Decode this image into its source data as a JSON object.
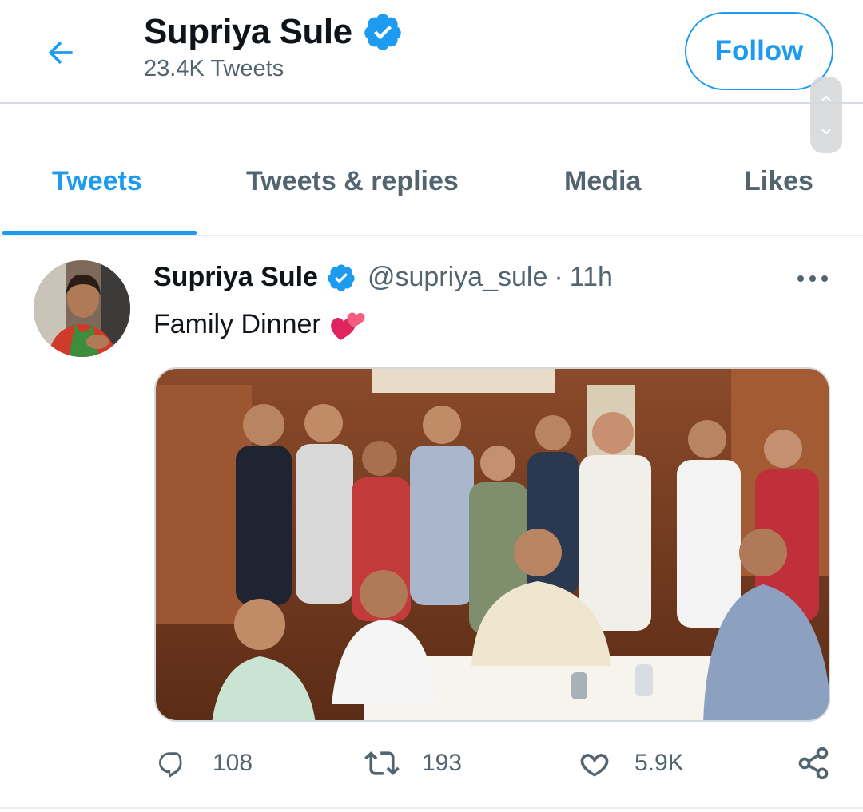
{
  "header": {
    "title": "Supriya Sule",
    "tweet_count": "23.4K Tweets",
    "follow_label": "Follow"
  },
  "tabs": [
    {
      "label": "Tweets",
      "active": true
    },
    {
      "label": "Tweets & replies",
      "active": false
    },
    {
      "label": "Media",
      "active": false
    },
    {
      "label": "Likes",
      "active": false
    }
  ],
  "tweet": {
    "author_name": "Supriya Sule",
    "handle": "@supriya_sule",
    "separator": "·",
    "time": "11h",
    "text": "Family Dinner",
    "stats": {
      "replies": "108",
      "retweets": "193",
      "likes": "5.9K"
    }
  },
  "colors": {
    "accent": "#1d9bf0",
    "text_primary": "#0f1419",
    "text_secondary": "#536471",
    "divider": "#e6ecf0"
  },
  "icons": {
    "back": "arrow-left-icon",
    "verified": "verified-badge-icon",
    "more": "more-dots-icon",
    "reply": "reply-icon",
    "retweet": "retweet-icon",
    "like": "heart-outline-icon",
    "share": "share-icon",
    "emoji": "two-hearts-emoji"
  }
}
